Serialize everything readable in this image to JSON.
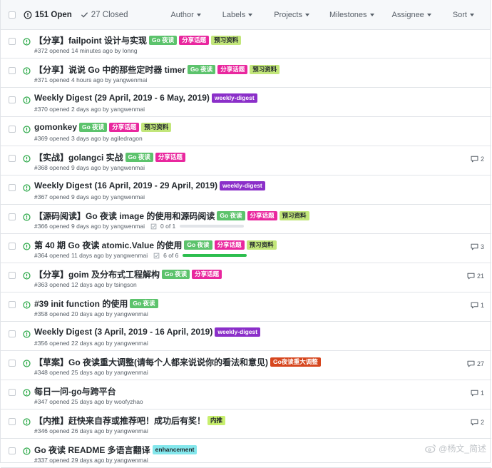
{
  "header": {
    "open_label": "151 Open",
    "closed_label": "27 Closed",
    "filters": [
      {
        "name": "author",
        "label": "Author"
      },
      {
        "name": "labels",
        "label": "Labels"
      },
      {
        "name": "projects",
        "label": "Projects"
      },
      {
        "name": "milestones",
        "label": "Milestones"
      },
      {
        "name": "assignee",
        "label": "Assignee"
      },
      {
        "name": "sort",
        "label": "Sort"
      }
    ]
  },
  "colors": {
    "open_green": "#28a745",
    "label_go": "#5cc36c",
    "label_share": "#e9279e",
    "label_preview": "#c2e67a",
    "label_weekly": "#8b2fc9",
    "label_adjust": "#d6461e",
    "label_neitui": "#c8ef6e",
    "label_enhancement": "#84e7ec"
  },
  "issues": [
    {
      "title": "【分享】failpoint 设计与实现",
      "meta": "#372 opened 14 minutes ago by lonng",
      "labels": [
        {
          "text": "Go 夜读",
          "bg": "#5cc36c",
          "fg": "#ffffff"
        },
        {
          "text": "分享话题",
          "bg": "#e9279e",
          "fg": "#ffffff"
        },
        {
          "text": "预习资料",
          "bg": "#c2e67a",
          "fg": "#24292e"
        }
      ]
    },
    {
      "title": "【分享】说说 Go 中的那些定时器 timer",
      "meta": "#371 opened 4 hours ago by yangwenmai",
      "labels": [
        {
          "text": "Go 夜读",
          "bg": "#5cc36c",
          "fg": "#ffffff"
        },
        {
          "text": "分享话题",
          "bg": "#e9279e",
          "fg": "#ffffff"
        },
        {
          "text": "预习资料",
          "bg": "#c2e67a",
          "fg": "#24292e"
        }
      ]
    },
    {
      "title": "Weekly Digest (29 April, 2019 - 6 May, 2019)",
      "meta": "#370 opened 2 days ago by yangwenmai",
      "labels": [
        {
          "text": "weekly-digest",
          "bg": "#8b2fc9",
          "fg": "#ffffff"
        }
      ]
    },
    {
      "title": "gomonkey",
      "meta": "#369 opened 3 days ago by agiledragon",
      "labels": [
        {
          "text": "Go 夜读",
          "bg": "#5cc36c",
          "fg": "#ffffff"
        },
        {
          "text": "分享话题",
          "bg": "#e9279e",
          "fg": "#ffffff"
        },
        {
          "text": "预习资料",
          "bg": "#c2e67a",
          "fg": "#24292e"
        }
      ]
    },
    {
      "title": "【实战】golangci 实战",
      "meta": "#368 opened 9 days ago by yangwenmai",
      "labels": [
        {
          "text": "Go 夜读",
          "bg": "#5cc36c",
          "fg": "#ffffff"
        },
        {
          "text": "分享话题",
          "bg": "#e9279e",
          "fg": "#ffffff"
        }
      ],
      "comments": "2"
    },
    {
      "title": "Weekly Digest (16 April, 2019 - 29 April, 2019)",
      "meta": "#367 opened 9 days ago by yangwenmai",
      "labels": [
        {
          "text": "weekly-digest",
          "bg": "#8b2fc9",
          "fg": "#ffffff"
        }
      ]
    },
    {
      "title": "【源码阅读】Go 夜读 image 的使用和源码阅读",
      "meta": "#366 opened 9 days ago by yangwenmai",
      "labels": [
        {
          "text": "Go 夜读",
          "bg": "#5cc36c",
          "fg": "#ffffff"
        },
        {
          "text": "分享话题",
          "bg": "#e9279e",
          "fg": "#ffffff"
        },
        {
          "text": "预习资料",
          "bg": "#c2e67a",
          "fg": "#24292e"
        }
      ],
      "progress": {
        "text": "0 of 1",
        "fraction": 0
      }
    },
    {
      "title": "第 40 期 Go 夜读 atomic.Value 的使用",
      "meta": "#364 opened 11 days ago by yangwenmai",
      "labels": [
        {
          "text": "Go 夜读",
          "bg": "#5cc36c",
          "fg": "#ffffff"
        },
        {
          "text": "分享话题",
          "bg": "#e9279e",
          "fg": "#ffffff"
        },
        {
          "text": "预习资料",
          "bg": "#c2e67a",
          "fg": "#24292e"
        }
      ],
      "progress": {
        "text": "6 of 6",
        "fraction": 1
      },
      "comments": "3"
    },
    {
      "title": "【分享】goim 及分布式工程解构",
      "meta": "#363 opened 12 days ago by tsingson",
      "labels": [
        {
          "text": "Go 夜读",
          "bg": "#5cc36c",
          "fg": "#ffffff"
        },
        {
          "text": "分享话题",
          "bg": "#e9279e",
          "fg": "#ffffff"
        }
      ],
      "comments": "21"
    },
    {
      "title": "#39 init function 的使用",
      "meta": "#358 opened 20 days ago by yangwenmai",
      "labels": [
        {
          "text": "Go 夜读",
          "bg": "#5cc36c",
          "fg": "#ffffff"
        }
      ],
      "comments": "1"
    },
    {
      "title": "Weekly Digest (3 April, 2019 - 16 April, 2019)",
      "meta": "#356 opened 22 days ago by yangwenmai",
      "labels": [
        {
          "text": "weekly-digest",
          "bg": "#8b2fc9",
          "fg": "#ffffff"
        }
      ]
    },
    {
      "title": "【草案】Go 夜读重大调整(请每个人都来说说你的看法和意见)",
      "meta": "#348 opened 25 days ago by yangwenmai",
      "labels": [
        {
          "text": "Go夜读重大调整",
          "bg": "#d6461e",
          "fg": "#ffffff"
        }
      ],
      "comments": "27"
    },
    {
      "title": "每日一问-go与跨平台",
      "meta": "#347 opened 25 days ago by woofyzhao",
      "labels": [],
      "comments": "1"
    },
    {
      "title": "【内推】赶快来自荐或推荐吧！成功后有奖！",
      "meta": "#346 opened 26 days ago by yangwenmai",
      "labels": [
        {
          "text": "内推",
          "bg": "#c8ef6e",
          "fg": "#24292e"
        }
      ],
      "comments": "2"
    },
    {
      "title": "Go 夜读 README 多语言翻译",
      "meta": "#337 opened 29 days ago by yangwenmai",
      "labels": [
        {
          "text": "enhancement",
          "bg": "#84e7ec",
          "fg": "#24292e"
        }
      ]
    }
  ],
  "watermark": "@杨文_简述"
}
